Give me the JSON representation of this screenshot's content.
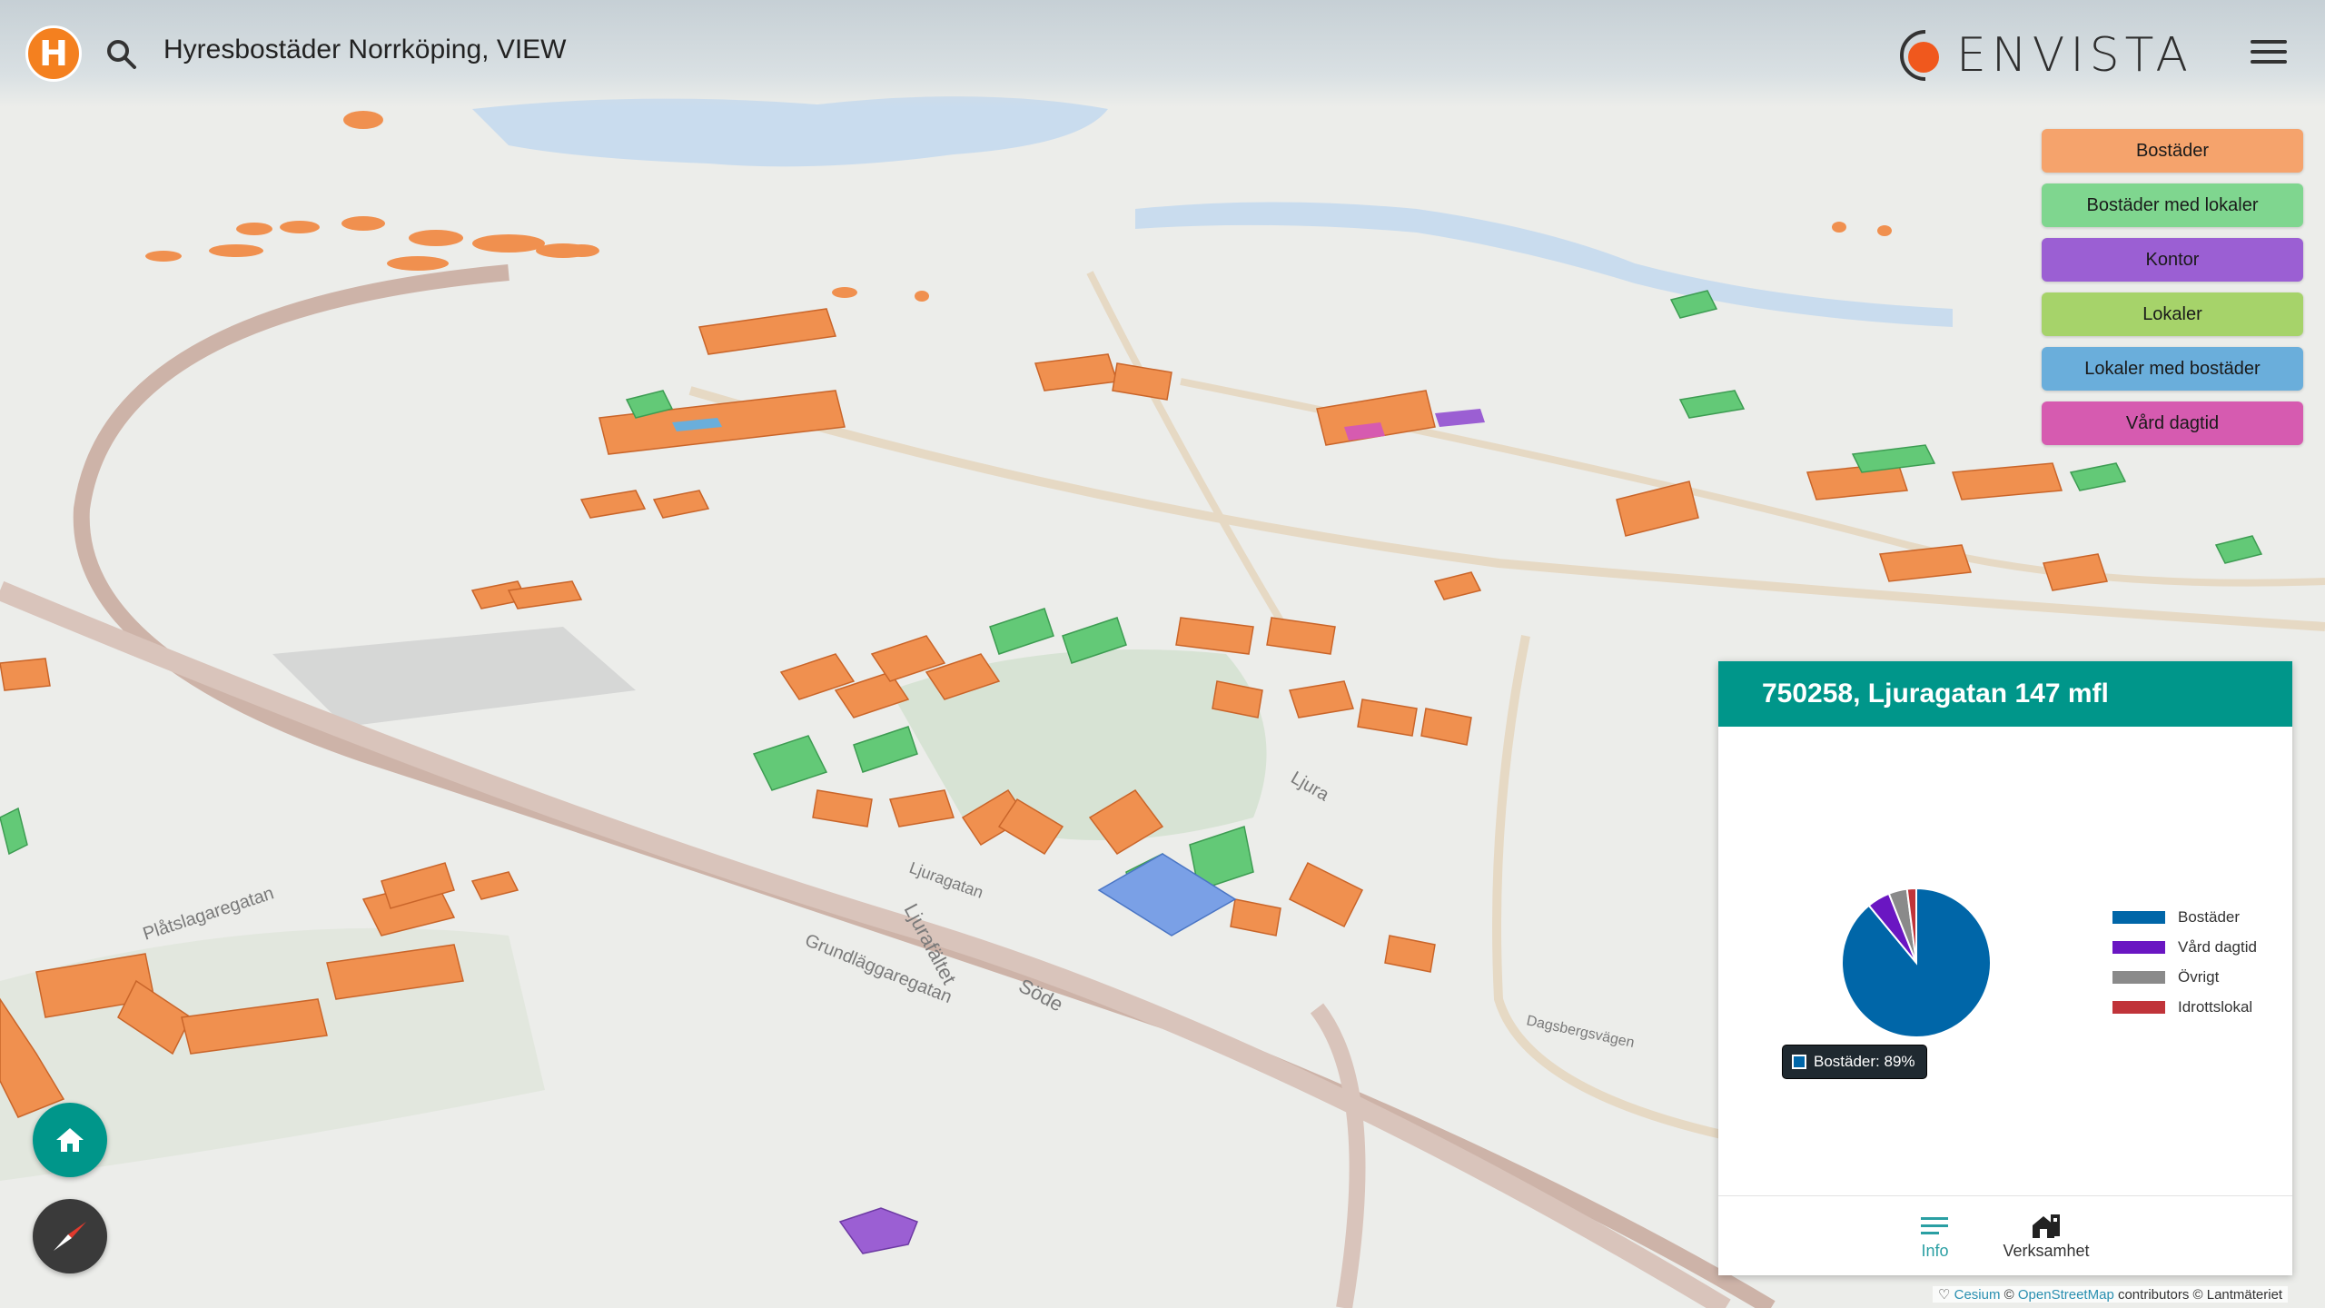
{
  "app": {
    "logo_letter": "H",
    "title": "Hyresbostäder Norrköping, VIEW",
    "brand": "ENVISTA"
  },
  "legend": [
    {
      "label": "Bostäder",
      "color": "#f5a36c"
    },
    {
      "label": "Bostäder med lokaler",
      "color": "#7fd68f"
    },
    {
      "label": "Kontor",
      "color": "#9b5fd3"
    },
    {
      "label": "Lokaler",
      "color": "#a6d36a"
    },
    {
      "label": "Lokaler med bostäder",
      "color": "#6aaedb"
    },
    {
      "label": "Vård dagtid",
      "color": "#d65bb0"
    }
  ],
  "panel": {
    "title": "750258, Ljuragatan 147 mfl",
    "tooltip": "Bostäder: 89%",
    "tabs": {
      "info": "Info",
      "business": "Verksamhet"
    }
  },
  "map_labels": {
    "ljuragatan": "Ljuragatan",
    "ljurafaltet": "Ljurafältet",
    "grundlaggaregatan": "Grundläggaregatan",
    "soder": "Söde",
    "dagsbergsvagen": "Dagsbergsvägen",
    "platslaggaregatan": "Plåtslagaregatan",
    "ljura": "Ljura"
  },
  "attribution": {
    "prefix": "♡",
    "cesium": "Cesium",
    "copy": "©",
    "osm": "OpenStreetMap",
    "rest": "contributors © Lantmäteriet"
  },
  "chart_data": {
    "type": "pie",
    "title": "",
    "categories": [
      "Bostäder",
      "Vård dagtid",
      "Övrigt",
      "Idrottslokal"
    ],
    "values": [
      89,
      5,
      4,
      2
    ],
    "colors": [
      "#0066a8",
      "#6a16c2",
      "#8a8a8a",
      "#c0343a"
    ],
    "legend_position": "right"
  }
}
